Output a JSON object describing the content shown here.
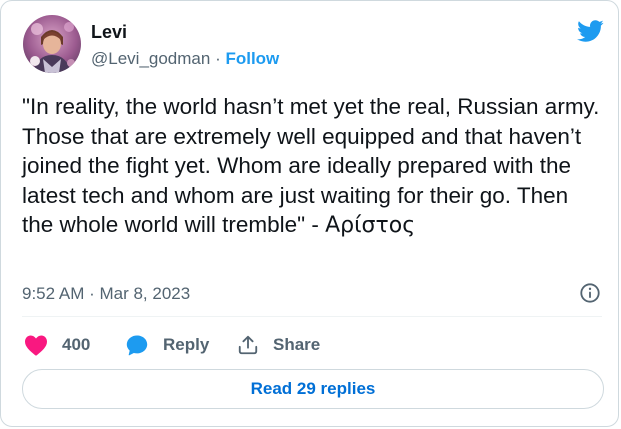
{
  "author": {
    "name": "Levi",
    "handle": "@Levi_godman",
    "separator": " · ",
    "follow_label": "Follow"
  },
  "tweet": {
    "text": "\"In reality, the world hasn’t met yet the real, Russian army. Those that are extremely well equipped and that haven’t joined the fight yet. Whom are ideally prepared with the latest tech and whom are just waiting for their go. Then the whole world will tremble\" - ",
    "signature": "Αρίστος",
    "timestamp": "9:52 AM · Mar 8, 2023"
  },
  "actions": {
    "like_count": "400",
    "reply_label": "Reply",
    "share_label": "Share",
    "read_replies_label": "Read 29 replies"
  },
  "colors": {
    "accent": "#1d9bf0",
    "link": "#006fd6",
    "like": "#f91880",
    "text": "#0f1419",
    "muted": "#536471",
    "border": "#cfd9de"
  },
  "icons": {
    "brand": "twitter-bird-icon",
    "info": "info-icon",
    "like": "heart-icon",
    "reply": "speech-bubble-icon",
    "share": "share-upload-icon"
  }
}
